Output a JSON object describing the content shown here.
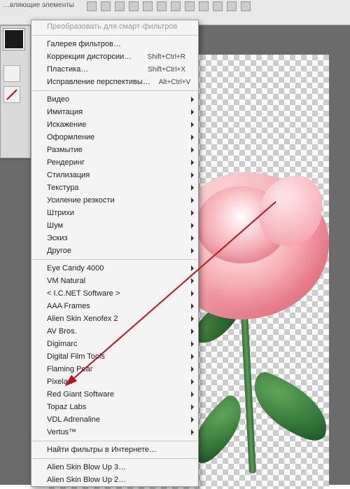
{
  "menubar": {
    "fragment_text": "…вляющие элементы"
  },
  "tab": {
    "label": "*"
  },
  "sidepanel_tab": {
    "label": "◄◄"
  },
  "menu": {
    "top_disabled": "Преобразовать для смарт-фильтров",
    "group1": [
      {
        "label": "Галерея фильтров…",
        "shortcut": "",
        "submenu": false
      },
      {
        "label": "Коррекция дисторсии…",
        "shortcut": "Shift+Ctrl+R",
        "submenu": false
      },
      {
        "label": "Пластика…",
        "shortcut": "Shift+Ctrl+X",
        "submenu": false
      },
      {
        "label": "Исправление перспективы…",
        "shortcut": "Alt+Ctrl+V",
        "submenu": false
      }
    ],
    "group2": [
      "Видео",
      "Имитация",
      "Искажение",
      "Оформление",
      "Размытие",
      "Рендеринг",
      "Стилизация",
      "Текстура",
      "Усиление резкости",
      "Штрихи",
      "Шум",
      "Эскиз",
      "Другое"
    ],
    "group3": [
      {
        "label": "Eye Candy 4000",
        "submenu": true
      },
      {
        "label": "VM Natural",
        "submenu": true
      },
      {
        "label": "< I.C.NET Software >",
        "submenu": true
      },
      {
        "label": "AAA Frames",
        "submenu": true
      },
      {
        "label": "Alien Skin Xenofex 2",
        "submenu": true
      },
      {
        "label": "AV Bros.",
        "submenu": true
      },
      {
        "label": "Digimarc",
        "submenu": true
      },
      {
        "label": "Digital Film Tools",
        "submenu": true
      },
      {
        "label": "Flaming Pear",
        "submenu": true
      },
      {
        "label": "Pixelan",
        "submenu": true
      },
      {
        "label": "Red Giant Software",
        "submenu": true
      },
      {
        "label": "Topaz Labs",
        "submenu": true
      },
      {
        "label": "VDL Adrenaline",
        "submenu": true
      },
      {
        "label": "Vertus™",
        "submenu": true
      }
    ],
    "browse": "Найти фильтры в Интернете…",
    "group4": [
      "Alien Skin Blow Up 3…",
      "Alien Skin Blow Up 2…"
    ]
  }
}
